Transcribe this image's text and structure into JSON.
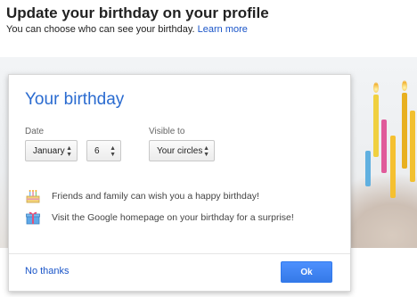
{
  "header": {
    "title": "Update your birthday on your profile",
    "subtitle": "You can choose who can see your birthday.",
    "learn_more": "Learn more"
  },
  "card": {
    "title": "Your birthday",
    "date_label": "Date",
    "month": "January",
    "day": "6",
    "visible_label": "Visible to",
    "visibility": "Your circles",
    "info_1": "Friends and family can wish you a happy birthday!",
    "info_2": "Visit the Google homepage on your birthday for a surprise!",
    "no_thanks": "No thanks",
    "ok": "Ok"
  },
  "colors": {
    "link": "#1a55c8",
    "accent": "#2a6bd0",
    "button": "#4d90fe"
  },
  "icons": [
    "cake-icon",
    "gift-icon",
    "updown-arrows-icon"
  ]
}
